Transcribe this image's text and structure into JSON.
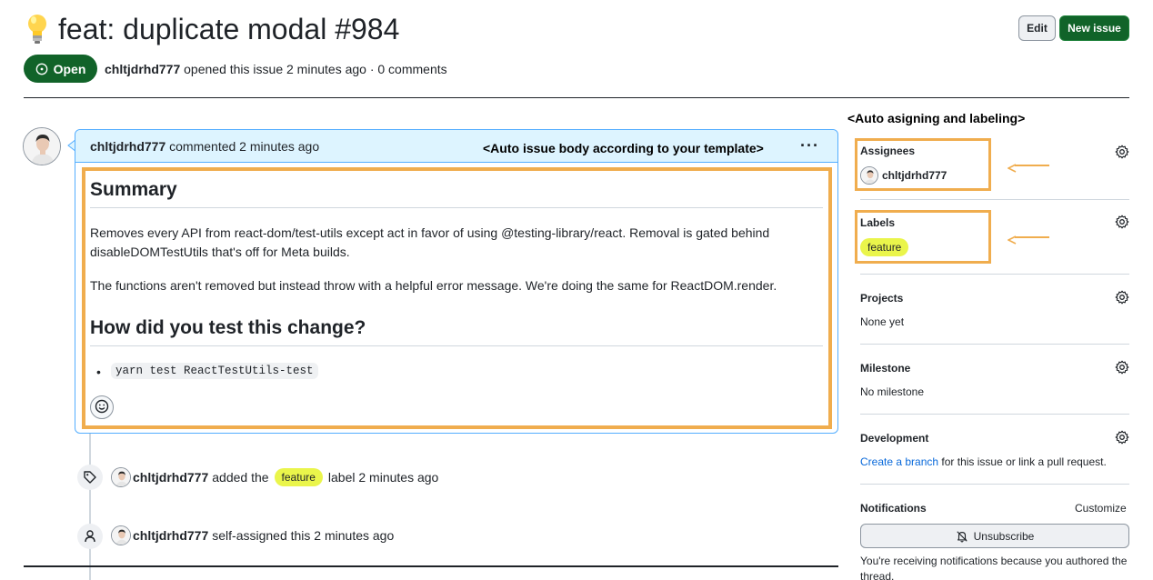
{
  "header": {
    "title": "feat: duplicate modal #984",
    "edit_label": "Edit",
    "new_issue_label": "New issue",
    "state_label": "Open",
    "author": "chltjdrhd777",
    "meta_suffix": "opened this issue 2 minutes ago · 0 comments"
  },
  "comment": {
    "author": "chltjdrhd777",
    "action": "commented 2 minutes ago",
    "annotation": "<Auto issue body according to your template>",
    "menu_label": "···",
    "heading_summary": "Summary",
    "paragraph1": "Removes every API from react-dom/test-utils except act in favor of using @testing-library/react. Removal is gated behind disableDOMTestUtils that's off for Meta builds.",
    "paragraph2": "The functions aren't removed but instead throw with a helpful error message. We're doing the same for ReactDOM.render.",
    "heading_test": "How did you test this change?",
    "list_items": [
      "yarn test ReactTestUtils-test"
    ]
  },
  "timeline": [
    {
      "icon": "tag-icon",
      "author": "chltjdrhd777",
      "pre": "added the",
      "label": "feature",
      "post": "label 2 minutes ago"
    },
    {
      "icon": "person-icon",
      "author": "chltjdrhd777",
      "text": "self-assigned this 2 minutes ago"
    }
  ],
  "sidebar": {
    "annotation": "<Auto asigning and labeling>",
    "assignees_title": "Assignees",
    "assignee": "chltjdrhd777",
    "labels_title": "Labels",
    "label": "feature",
    "projects_title": "Projects",
    "projects_value": "None yet",
    "milestone_title": "Milestone",
    "milestone_value": "No milestone",
    "development_title": "Development",
    "development_link": "Create a branch",
    "development_text": "for this issue or link a pull request.",
    "notifications_title": "Notifications",
    "customize_label": "Customize",
    "unsubscribe_label": "Unsubscribe",
    "notifications_text": "You're receiving notifications because you authored the thread."
  },
  "colors": {
    "open_green": "#116329",
    "annotation_orange": "#f0ad4e",
    "label_yellow": "#eaf54b",
    "comment_header": "#ddf4ff",
    "link_blue": "#0969da"
  }
}
